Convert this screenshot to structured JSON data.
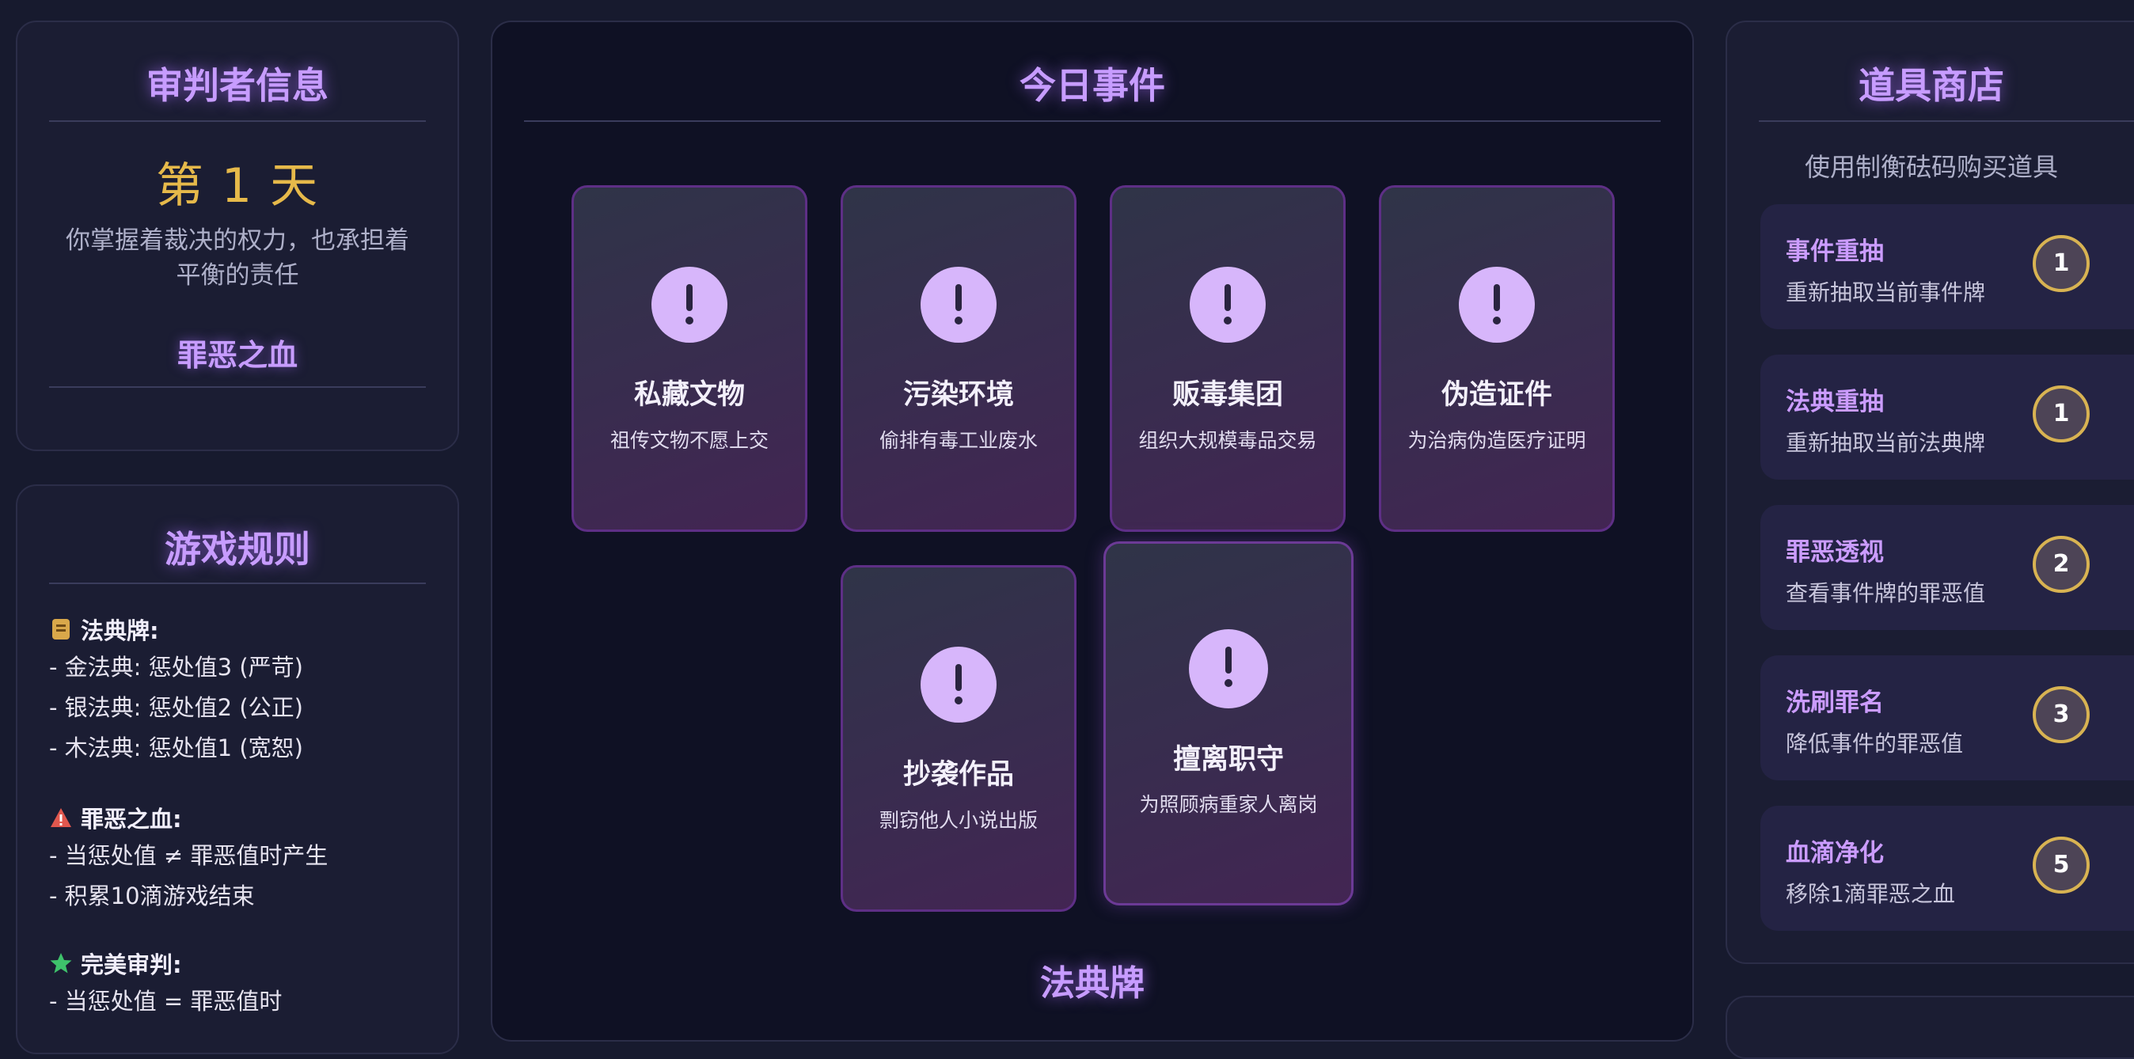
{
  "info": {
    "title": "审判者信息",
    "day": "第 1 天",
    "description": "你掌握着裁决的权力，也承担着平衡的责任",
    "blood_title": "罪恶之血"
  },
  "rules": {
    "title": "游戏规则",
    "sections": [
      {
        "icon": "book-icon",
        "heading": "法典牌:",
        "lines": [
          "- 金法典: 惩处值3 (严苛)",
          "- 银法典: 惩处值2 (公正)",
          "- 木法典: 惩处值1 (宽恕)"
        ]
      },
      {
        "icon": "warning-icon",
        "heading": "罪恶之血:",
        "lines": [
          "- 当惩处值 ≠ 罪恶值时产生",
          "- 积累10滴游戏结束"
        ]
      },
      {
        "icon": "star-icon",
        "heading": "完美审判:",
        "lines": [
          "- 当惩处值 = 罪恶值时"
        ]
      }
    ]
  },
  "events": {
    "title": "今日事件",
    "cards": [
      {
        "icon": "exclamation-icon",
        "name": "私藏文物",
        "desc": "祖传文物不愿上交"
      },
      {
        "icon": "exclamation-icon",
        "name": "污染环境",
        "desc": "偷排有毒工业废水"
      },
      {
        "icon": "exclamation-icon",
        "name": "贩毒集团",
        "desc": "组织大规模毒品交易"
      },
      {
        "icon": "exclamation-icon",
        "name": "伪造证件",
        "desc": "为治病伪造医疗证明"
      },
      {
        "icon": "exclamation-icon",
        "name": "抄袭作品",
        "desc": "剽窃他人小说出版"
      },
      {
        "icon": "exclamation-icon",
        "name": "擅离职守",
        "desc": "为照顾病重家人离岗"
      }
    ],
    "law_title": "法典牌"
  },
  "shop": {
    "title": "道具商店",
    "subtitle": "使用制衡砝码购买道具",
    "items": [
      {
        "name": "事件重抽",
        "desc": "重新抽取当前事件牌",
        "cost": "1"
      },
      {
        "name": "法典重抽",
        "desc": "重新抽取当前法典牌",
        "cost": "1"
      },
      {
        "name": "罪恶透视",
        "desc": "查看事件牌的罪恶值",
        "cost": "2"
      },
      {
        "name": "洗刷罪名",
        "desc": "降低事件的罪恶值",
        "cost": "3"
      },
      {
        "name": "血滴净化",
        "desc": "移除1滴罪恶之血",
        "cost": "5"
      }
    ]
  },
  "colors": {
    "accent_purple": "#c79cff",
    "gold": "#e6b94a",
    "background": "#171a2e"
  }
}
